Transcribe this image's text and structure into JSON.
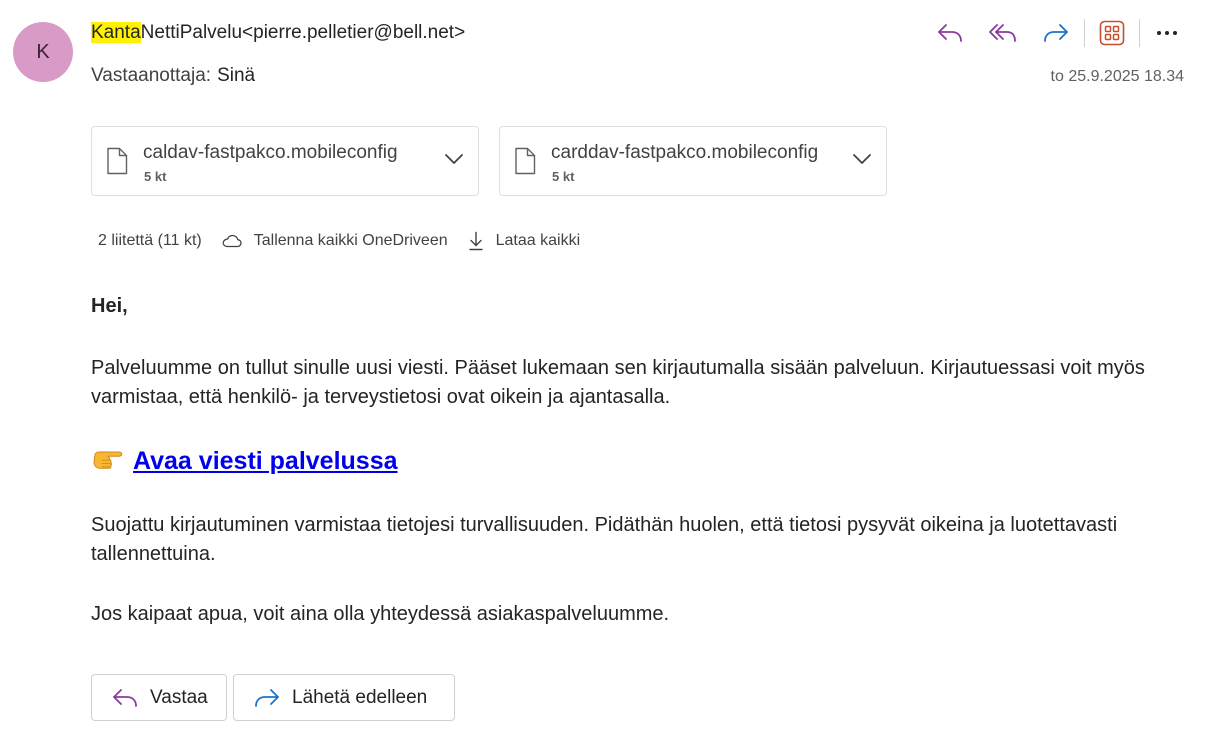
{
  "header": {
    "avatar_initial": "K",
    "sender_highlight": "Kanta",
    "sender_rest": "NettiPalvelu<pierre.pelletier@bell.net>",
    "recipient_label": "Vastaanottaja:",
    "recipient_value": "Sinä",
    "date": "to 25.9.2025 18.34",
    "avatar_color": "#d89ac6",
    "highlight_color": "#fff200",
    "actions": [
      "reply-icon",
      "reply-all-icon",
      "forward-icon",
      "apps-icon",
      "more-icon"
    ]
  },
  "attachments": {
    "items": [
      {
        "name": "caldav-fastpakco.mobileconfig",
        "size": "5 kt"
      },
      {
        "name": "carddav-fastpakco.mobileconfig",
        "size": "5 kt"
      }
    ],
    "summary": "2 liitettä (11 kt)",
    "save_all": "Tallenna kaikki OneDriveen",
    "download_all": "Lataa kaikki"
  },
  "body": {
    "greeting": "Hei,",
    "paragraph1": "Palveluumme on tullut sinulle uusi viesti. Pääset lukemaan sen kirjautumalla sisään palveluun. Kirjautuessasi voit myös varmistaa, että henkilö- ja terveystietosi ovat oikein ja ajantasalla.",
    "cta_emoji": "👉",
    "cta_label": "Avaa viesti palvelussa",
    "paragraph2": "Suojattu kirjautuminen varmistaa tietojesi turvallisuuden. Pidäthän huolen, että tietosi pysyvät oikeina ja luotettavasti tallennettuina.",
    "paragraph3": "Jos kaipaat apua, voit aina olla yhteydessä asiakaspalveluumme.",
    "link_color": "#0000ee"
  },
  "footer": {
    "reply_label": "Vastaa",
    "forward_label": "Lähetä edelleen"
  }
}
